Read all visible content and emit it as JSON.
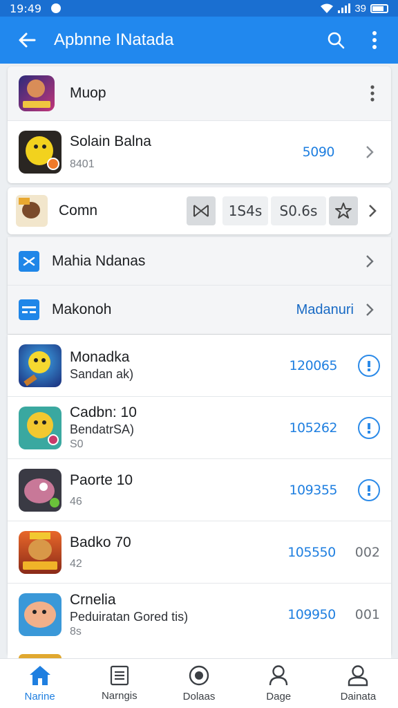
{
  "status": {
    "time": "19:49",
    "battery": "39"
  },
  "appbar": {
    "title": "Apbnne INatada",
    "back_icon": "arrow-left-icon",
    "search_icon": "search-icon",
    "menu_icon": "more-vertical-icon"
  },
  "section1": {
    "header": {
      "name": "Muop"
    },
    "item": {
      "name": "Solain Balna",
      "meta": "8401",
      "value": "5090"
    }
  },
  "compare": {
    "name": "Comn",
    "left_value": "1S4s",
    "right_value": "S0.6s"
  },
  "menu": {
    "item1": {
      "label": "Mahia Ndanas"
    },
    "item2": {
      "label": "Makonoh",
      "value": "Madanuri"
    }
  },
  "list": [
    {
      "name": "Monadka",
      "sub": "Sandan ak)",
      "meta": "",
      "value": "120065",
      "trail": "download"
    },
    {
      "name": "Cadbn: 10",
      "sub": "BendatrSA)",
      "meta": "S0",
      "value": "105262",
      "trail": "download"
    },
    {
      "name": "Paorte 10",
      "sub": "",
      "meta": "46",
      "value": "109355",
      "trail": "download"
    },
    {
      "name": "Badko 70",
      "sub": "",
      "meta": "42",
      "value": "105550",
      "trail": "002"
    },
    {
      "name": "Crnelia",
      "sub": "Peduiratan Gored tis)",
      "meta": "8s",
      "value": "109950",
      "trail": "001"
    }
  ],
  "bottom_nav": [
    {
      "label": "Narine",
      "icon": "home-icon",
      "active": true
    },
    {
      "label": "Narngis",
      "icon": "list-icon",
      "active": false
    },
    {
      "label": "Dolaas",
      "icon": "record-icon",
      "active": false
    },
    {
      "label": "Dage",
      "icon": "person-icon",
      "active": false
    },
    {
      "label": "Dainata",
      "icon": "profile-icon",
      "active": false
    }
  ],
  "colors": {
    "accent": "#2188ee",
    "status": "#1a6fd1",
    "value_blue": "#1f7fe0",
    "background": "#eceff2"
  }
}
